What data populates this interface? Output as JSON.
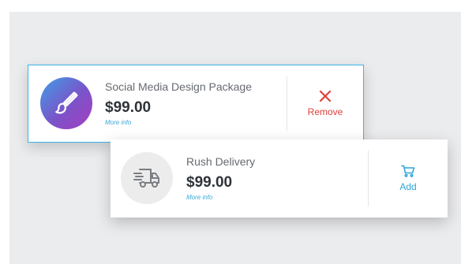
{
  "items": [
    {
      "title": "Social Media Design Package",
      "price": "$99.00",
      "more_info": "More info",
      "action_label": "Remove",
      "action_icon": "close-icon",
      "thumb_icon": "paintbrush-icon"
    },
    {
      "title": "Rush Delivery",
      "price": "$99.00",
      "more_info": "More info",
      "action_label": "Add",
      "action_icon": "cart-icon",
      "thumb_icon": "delivery-truck-icon"
    }
  ],
  "colors": {
    "background": "#ebecee",
    "selected_border": "#3ab4e6",
    "remove": "#e0403a",
    "add": "#2fa6dc",
    "gradient_start": "#3d9fe6",
    "gradient_end": "#a63ec0"
  }
}
